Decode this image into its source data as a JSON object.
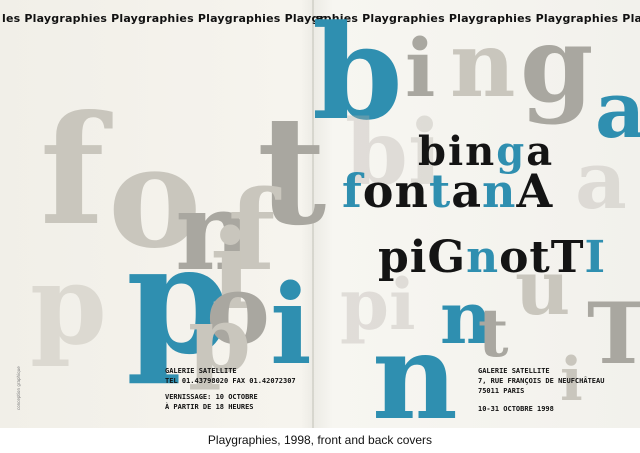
{
  "banner": {
    "left": "les Playgraphies Playgraphies Playgraphies Playgr",
    "right": "aphies Playgraphies Playgraphies Playgraphies Playgraphi"
  },
  "title": {
    "line1": [
      "b",
      "i",
      "n",
      "g",
      "a"
    ],
    "line2": [
      "f",
      "o",
      "n",
      "t",
      "a",
      "n",
      "A"
    ],
    "line3": [
      "p",
      "i",
      "G",
      "n",
      "o",
      "t",
      "T",
      "I"
    ]
  },
  "left_info": {
    "gallery": "GALERIE SATELLITE",
    "phone": "TEL 01.43798020 FAX 01.42072307",
    "vernissage": "VERNISSAGE: 10 OCTOBRE",
    "time": "À PARTIR DE 18 HEURES"
  },
  "right_info": {
    "gallery": "GALERIE SATELLITE",
    "address": "7, RUE FRANÇOIS DE NEUFCHÂTEAU",
    "city": "75011 PARIS",
    "dates": "10-31 OCTOBRE 1998"
  },
  "credit": "conception graphique",
  "caption": "Playgraphies, 1998, front and back covers",
  "colors": {
    "blue": "#2f8fb0",
    "grey": "#a9a7a0",
    "light_grey": "#c9c6bd",
    "ink": "#141414"
  }
}
